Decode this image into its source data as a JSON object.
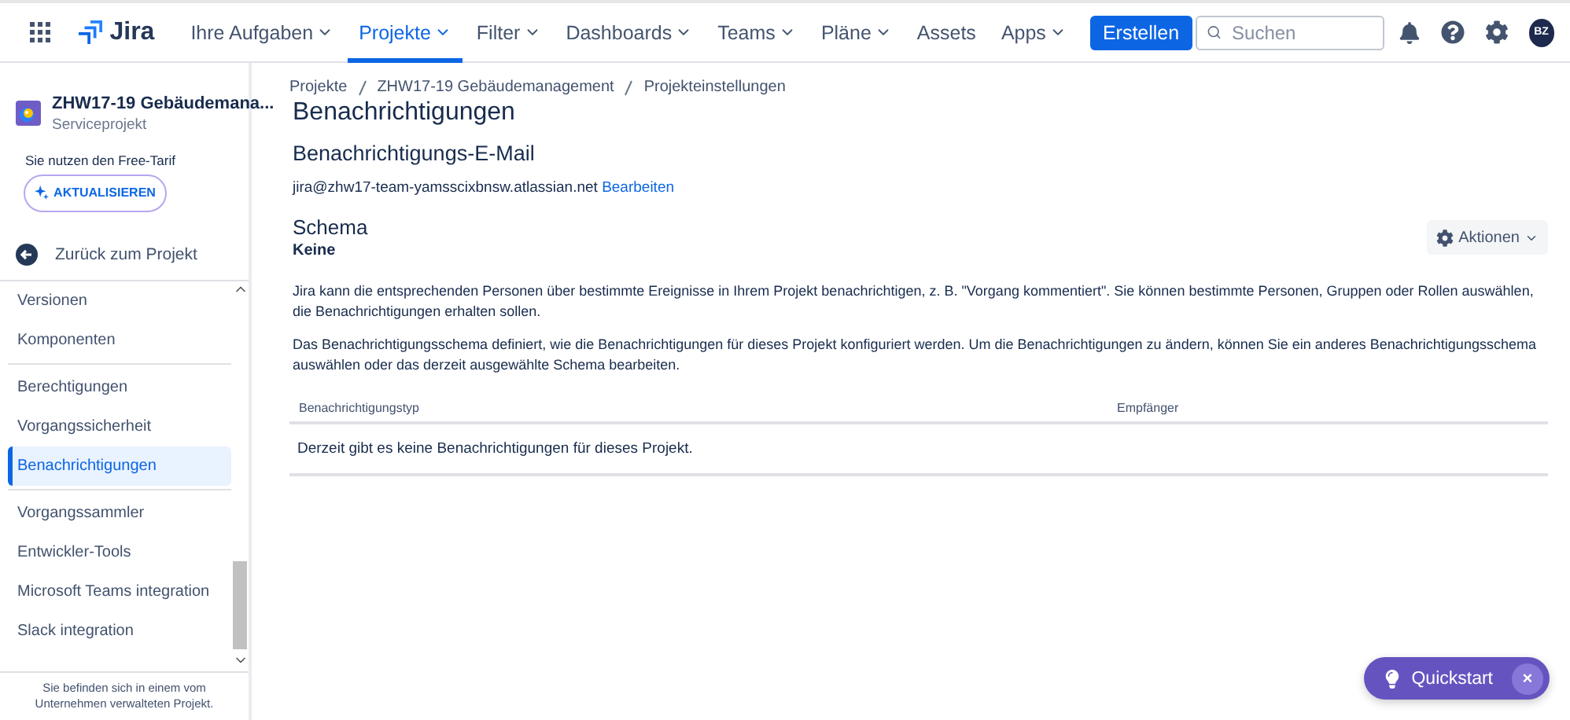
{
  "topbar": {
    "logo": "Jira",
    "nav": [
      {
        "label": "Ihre Aufgaben",
        "selected": false,
        "has_menu": true
      },
      {
        "label": "Projekte",
        "selected": true,
        "has_menu": true
      },
      {
        "label": "Filter",
        "selected": false,
        "has_menu": true
      },
      {
        "label": "Dashboards",
        "selected": false,
        "has_menu": true
      },
      {
        "label": "Teams",
        "selected": false,
        "has_menu": true
      },
      {
        "label": "Pläne",
        "selected": false,
        "has_menu": true
      },
      {
        "label": "Assets",
        "selected": false,
        "has_menu": false
      },
      {
        "label": "Apps",
        "selected": false,
        "has_menu": true
      }
    ],
    "create_button": "Erstellen",
    "search": {
      "placeholder": "Suchen"
    },
    "avatar": "BZ"
  },
  "sidebar": {
    "project": {
      "name": "ZHW17-19 Gebäudemana...",
      "type": "Serviceprojekt"
    },
    "plan_note": "Sie nutzen den Free-Tarif",
    "upgrade_button": "AKTUALISIEREN",
    "back_link": "Zurück zum Projekt",
    "groups": [
      [
        {
          "label": "Versionen",
          "selected": false
        },
        {
          "label": "Komponenten",
          "selected": false
        }
      ],
      [
        {
          "label": "Berechtigungen",
          "selected": false
        },
        {
          "label": "Vorgangssicherheit",
          "selected": false
        },
        {
          "label": "Benachrichtigungen",
          "selected": true
        }
      ],
      [
        {
          "label": "Vorgangssammler",
          "selected": false
        },
        {
          "label": "Entwickler-Tools",
          "selected": false
        },
        {
          "label": "Microsoft Teams integration",
          "selected": false
        },
        {
          "label": "Slack integration",
          "selected": false
        }
      ]
    ],
    "footer": "Sie befinden sich in einem vom Unternehmen verwalteten Projekt."
  },
  "breadcrumbs": [
    "Projekte",
    "ZHW17-19 Gebäudemanagement",
    "Projekteinstellungen"
  ],
  "title": "Benachrichtigungen",
  "email_section": {
    "heading": "Benachrichtigungs-E-Mail",
    "address": "jira@zhw17-team-yamsscixbnsw.atlassian.net",
    "edit_link": "Bearbeiten"
  },
  "schema_section": {
    "heading": "Schema",
    "actions_button": "Aktionen",
    "name": "Keine",
    "paragraphs": [
      "Jira kann die entsprechenden Personen über bestimmte Ereignisse in Ihrem Projekt benachrichtigen, z. B. \"Vorgang kommentiert\". Sie können bestimmte Personen, Gruppen oder Rollen auswählen, die Benachrichtigungen erhalten sollen.",
      "Das Benachrichtigungsschema definiert, wie die Benachrichtigungen für dieses Projekt konfiguriert werden. Um die Benachrichtigungen zu ändern, können Sie ein anderes Benachrichtigungsschema auswählen oder das derzeit ausgewählte Schema bearbeiten."
    ],
    "table": {
      "columns": [
        "Benachrichtigungstyp",
        "Empfänger"
      ],
      "empty_message": "Derzeit gibt es keine Benachrichtigungen für dieses Projekt."
    }
  },
  "quickstart": {
    "label": "Quickstart",
    "close": "×"
  }
}
